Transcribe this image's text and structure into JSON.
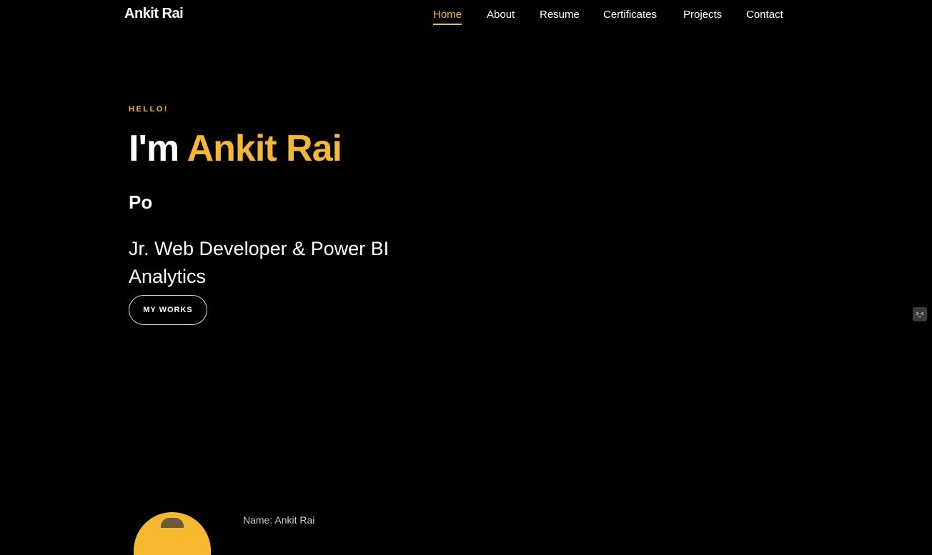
{
  "navbar": {
    "brand": "Ankit Rai",
    "links": [
      {
        "label": "Home",
        "active": true
      },
      {
        "label": "About",
        "active": false
      },
      {
        "label": "Resume",
        "active": false
      },
      {
        "label": "Certificates",
        "active": false
      },
      {
        "label": "Projects",
        "active": false
      },
      {
        "label": "Contact",
        "active": false
      }
    ]
  },
  "hero": {
    "greeting": "HELLO!",
    "title_prefix": "I'm ",
    "title_name": "Ankit Rai",
    "typed_text": "Po",
    "subtitle": "Jr. Web Developer & Power BI Analytics",
    "cta_label": "MY WORKS"
  },
  "about": {
    "info_line": "Name: Ankit Rai"
  },
  "colors": {
    "background": "#000000",
    "accent": "#f5b82e",
    "text": "#ffffff"
  },
  "icons": {
    "side_widget": "emoji-face-icon"
  }
}
